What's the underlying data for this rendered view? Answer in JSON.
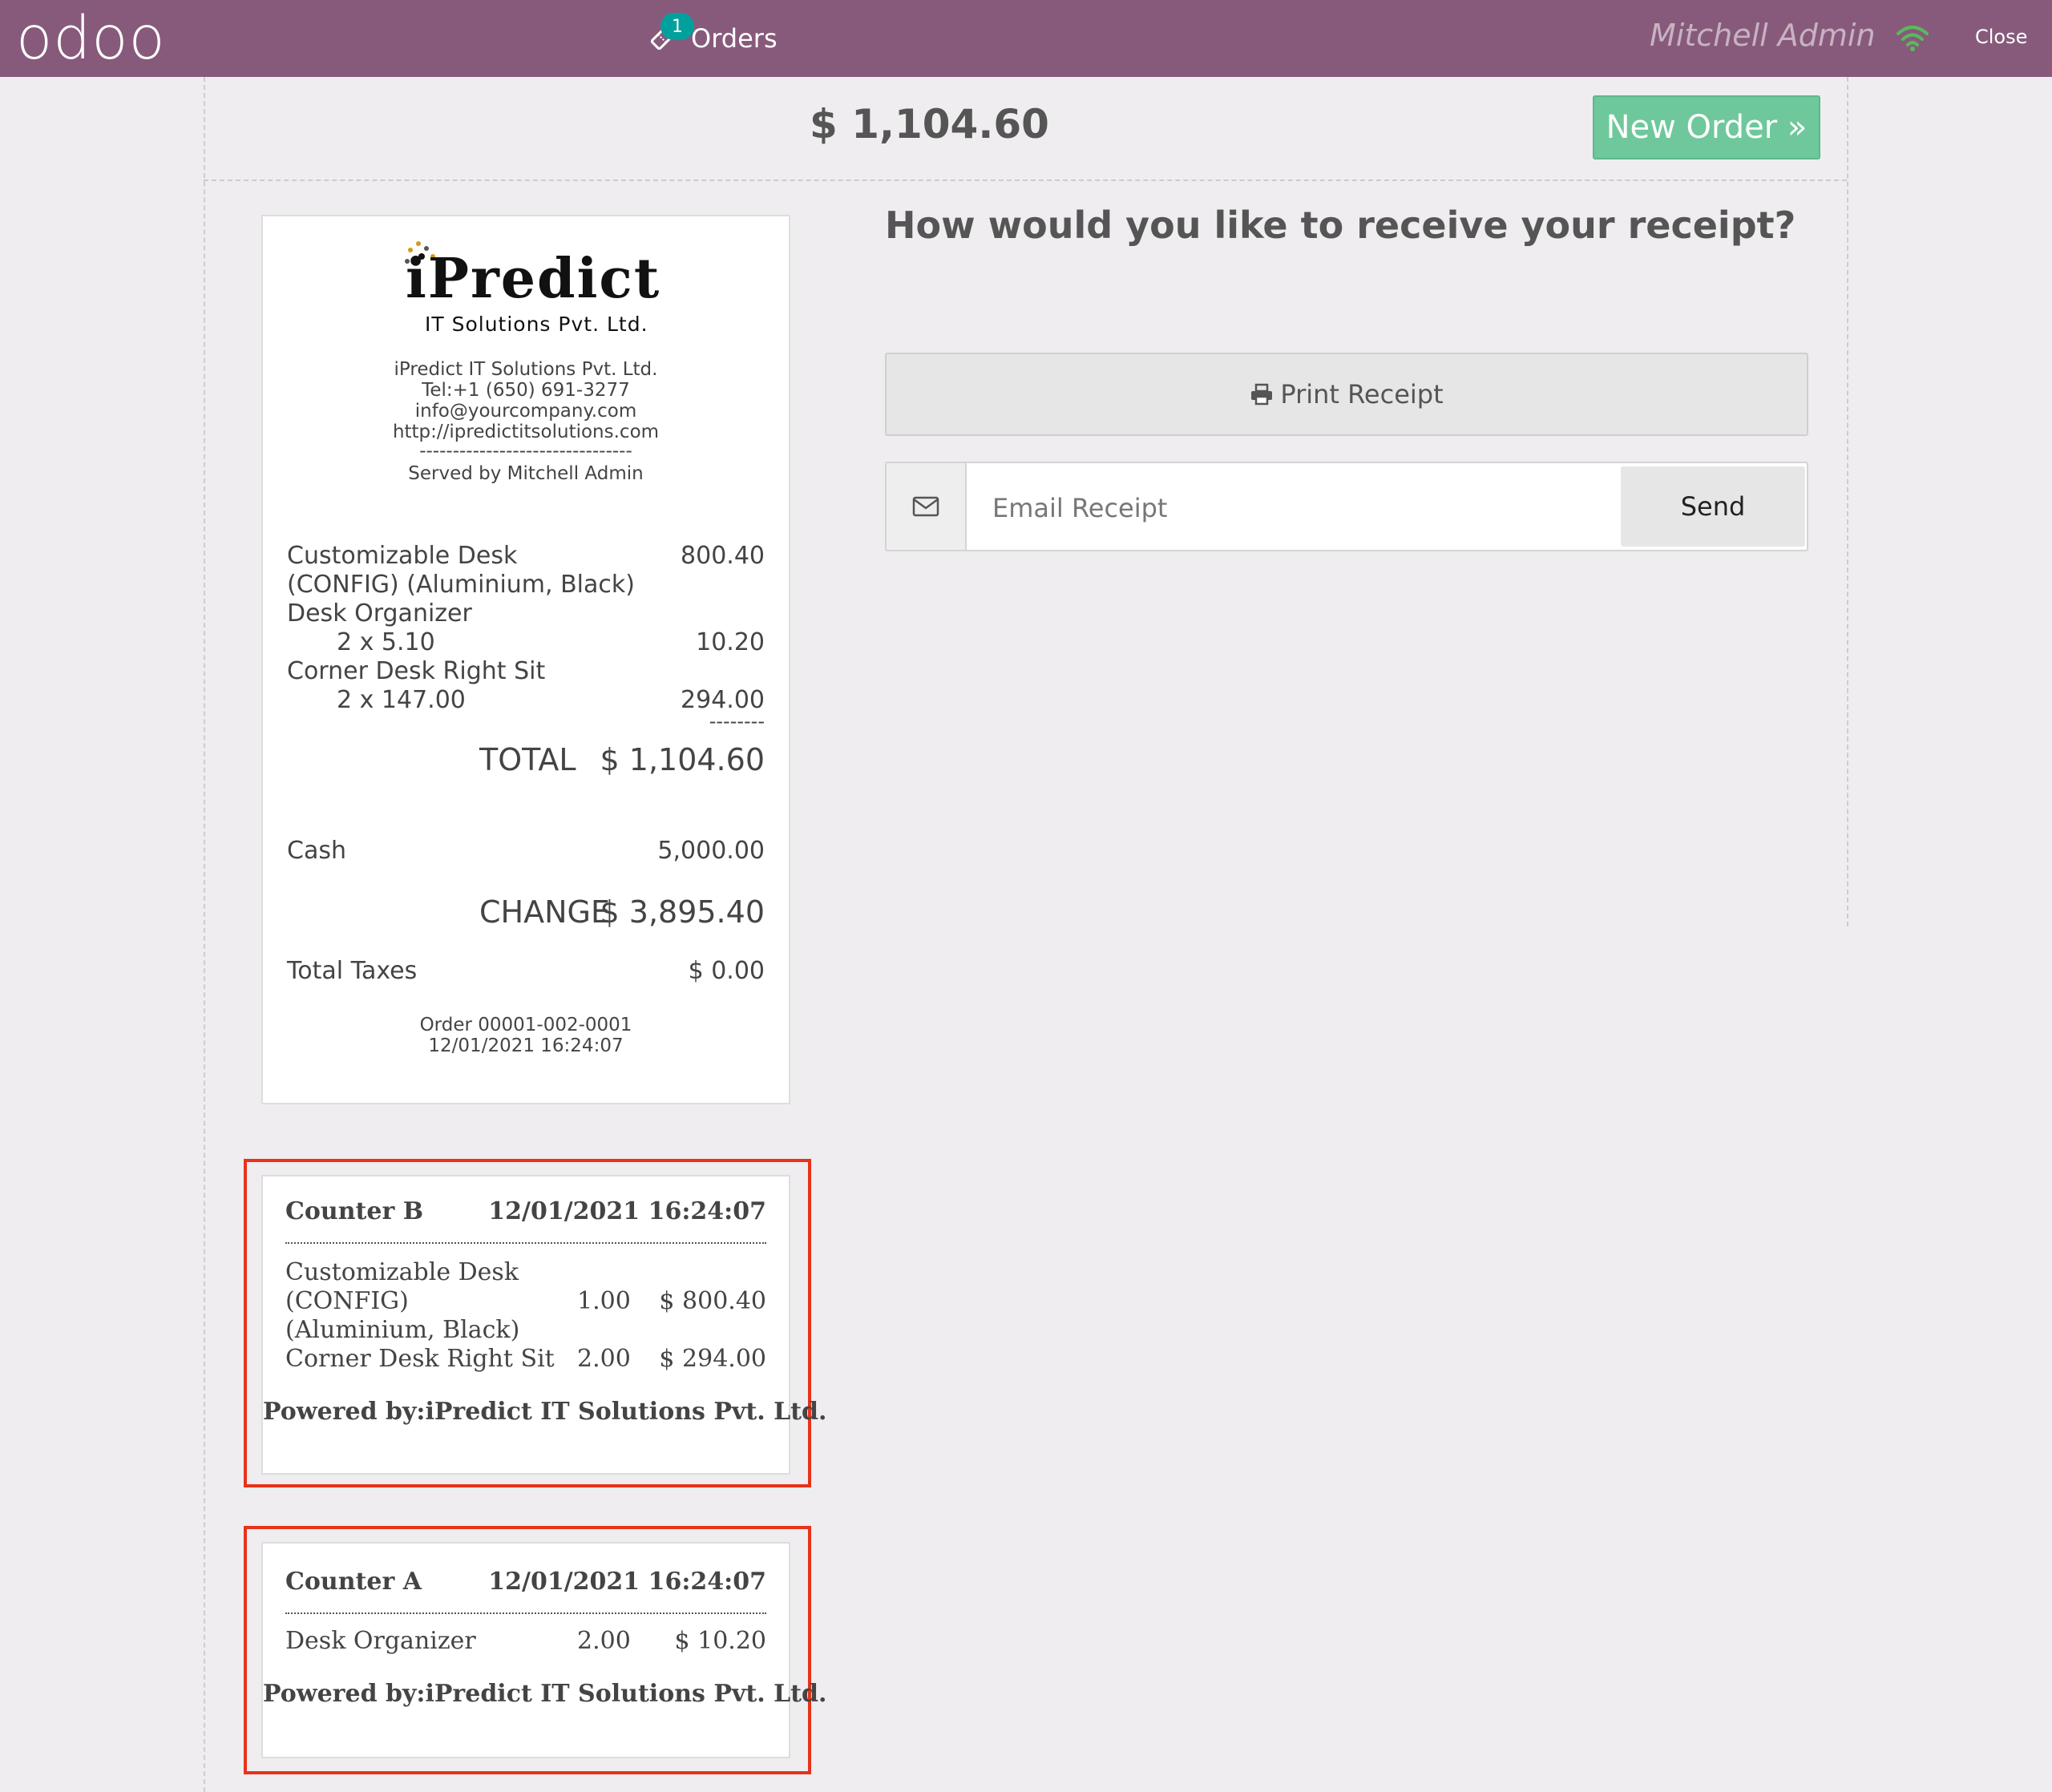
{
  "navbar": {
    "logo": "odoo",
    "orders_label": "Orders",
    "orders_badge": "1",
    "cashier": "Mitchell Admin",
    "close_label": "Close",
    "wifi_icon": "wifi-icon",
    "wifi_color": "#5cb85c",
    "bg_color": "#875a7b"
  },
  "top": {
    "amount": "$ 1,104.60",
    "new_order_label": "New Order »"
  },
  "receipt": {
    "logo_text": "iPredict",
    "logo_subtitle": "IT Solutions Pvt. Ltd.",
    "company_name": "iPredict IT Solutions Pvt. Ltd.",
    "phone": "Tel:+1 (650) 691-3277",
    "email": "info@yourcompany.com",
    "website": "http://ipredictitsolutions.com",
    "separator": "--------------------------------",
    "served_by": "Served by Mitchell Admin",
    "lines": [
      {
        "name_1": "Customizable Desk",
        "name_2": "(CONFIG) (Aluminium, Black)",
        "price": "800.40"
      },
      {
        "name_1": "Desk Organizer",
        "qty": "2 x 5.10",
        "price": "10.20"
      },
      {
        "name_1": "Corner Desk Right Sit",
        "qty": "2 x 147.00",
        "price": "294.00"
      }
    ],
    "total_separator": "--------",
    "total_label": "TOTAL",
    "total_value": "$ 1,104.60",
    "payment_label": "Cash",
    "payment_value": "5,000.00",
    "change_label": "CHANGE",
    "change_value": "$ 3,895.40",
    "taxes_label": "Total Taxes",
    "taxes_value": "$ 0.00",
    "order_ref": "Order 00001-002-0001",
    "order_date": "12/01/2021 16:24:07"
  },
  "receive": {
    "question": "How would you like to receive your receipt?",
    "print_label": "Print Receipt",
    "email_placeholder": "Email Receipt",
    "send_label": "Send"
  },
  "tickets": [
    {
      "counter": "Counter B",
      "datetime": "12/01/2021 16:24:07",
      "items": [
        {
          "name_1": "Customizable Desk",
          "name_2": "(CONFIG)",
          "name_3": "(Aluminium, Black)",
          "qty": "1.00",
          "amount": "$ 800.40"
        },
        {
          "name_1": "Corner Desk Right Sit",
          "qty": "2.00",
          "amount": "$ 294.00"
        }
      ],
      "footer": "Powered by:iPredict IT Solutions Pvt. Ltd."
    },
    {
      "counter": "Counter A",
      "datetime": "12/01/2021 16:24:07",
      "items": [
        {
          "name_1": "Desk Organizer",
          "qty": "2.00",
          "amount": "$ 10.20"
        }
      ],
      "footer": "Powered by:iPredict IT Solutions Pvt. Ltd."
    }
  ],
  "highlight_color": "#e8321a",
  "accent_green": "#6ec89b"
}
